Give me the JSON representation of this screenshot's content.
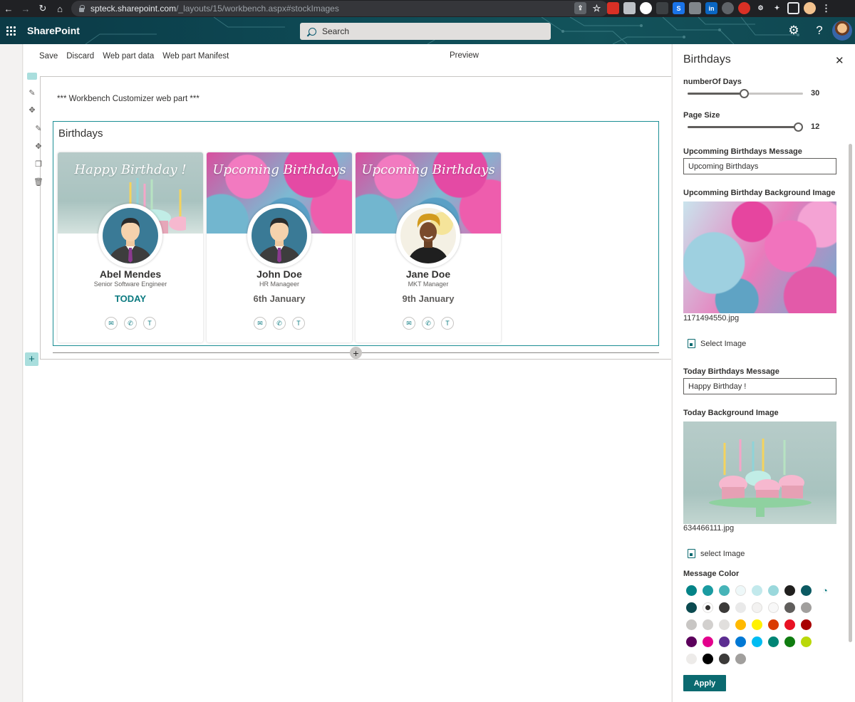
{
  "browser": {
    "url_host": "spteck.sharepoint.com",
    "url_path": "/_layouts/15/workbench.aspx#stockImages",
    "back_icon": "arrow-left-icon",
    "forward_icon": "arrow-right-icon",
    "reload_icon": "reload-icon",
    "home_icon": "home-icon"
  },
  "suitebar": {
    "app_name": "SharePoint",
    "search_placeholder": "Search",
    "settings_icon": "⚙",
    "help_icon": "?"
  },
  "commandbar": {
    "save": "Save",
    "discard": "Discard",
    "web_part_data": "Web part data",
    "web_part_manifest": "Web part Manifest",
    "preview": "Preview"
  },
  "canvas": {
    "customizer_text": "*** Workbench Customizer web part ***",
    "webpart_title": "Birthdays",
    "cards": [
      {
        "caption": "Happy Birthday !",
        "name": "Abel Mendes",
        "job": "Senior Software Engineer",
        "date": "TODAY",
        "today": true,
        "bg": "cupcake",
        "photo": "male"
      },
      {
        "caption": "Upcoming Birthdays",
        "name": "John Doe",
        "job": "HR Manageer",
        "date": "6th January",
        "today": false,
        "bg": "balloon",
        "photo": "male"
      },
      {
        "caption": "Upcoming Birthdays",
        "name": "Jane Doe",
        "job": "MKT Manager",
        "date": "9th January",
        "today": false,
        "bg": "balloon",
        "photo": "female"
      }
    ]
  },
  "pane": {
    "title": "Birthdays",
    "number_of_days_label": "numberOf Days",
    "number_of_days_value": "30",
    "number_of_days_fraction": 0.49,
    "page_size_label": "Page Size",
    "page_size_value": "12",
    "page_size_fraction": 1.0,
    "upcoming_message_label": "Upcomming Birthdays Message",
    "upcoming_message_value": "Upcoming Birthdays",
    "upcoming_bg_label": "Upcomming Birthday Background Image",
    "upcoming_bg_file": "1171494550.jpg",
    "select_image_1": "Select Image",
    "today_message_label": "Today Birthdays Message",
    "today_message_value": "Happy Birthday !",
    "today_bg_label": "Today Background Image",
    "today_bg_file": "634466111.jpg",
    "select_image_2": "select Image",
    "message_color_label": "Message Color",
    "apply": "Apply",
    "colors": [
      "#038387",
      "#1a9ba1",
      "#46b4b8",
      "#eef8f9",
      "#c2e9ec",
      "#9ad8dc",
      "#201f1e",
      "#0b5a62",
      "#0b4a50",
      "#ffffff",
      "#3b3a39",
      "#e9e9e9",
      "#f3f2f1",
      "#f8f8f8",
      "#605e5c",
      "#a19f9d",
      "#c8c6c4",
      "#d2d0ce",
      "#e1dfdd",
      "#ffb900",
      "#fff100",
      "#da3b01",
      "#e81123",
      "#a80000",
      "#5c005c",
      "#e3008c",
      "#5c2d91",
      "#0078d4",
      "#00bcf2",
      "#008575",
      "#107c10",
      "#bad80a",
      "#edebe9",
      "#000000",
      "#3b3a39",
      "#a19f9d"
    ],
    "selected_color_index": 9
  }
}
